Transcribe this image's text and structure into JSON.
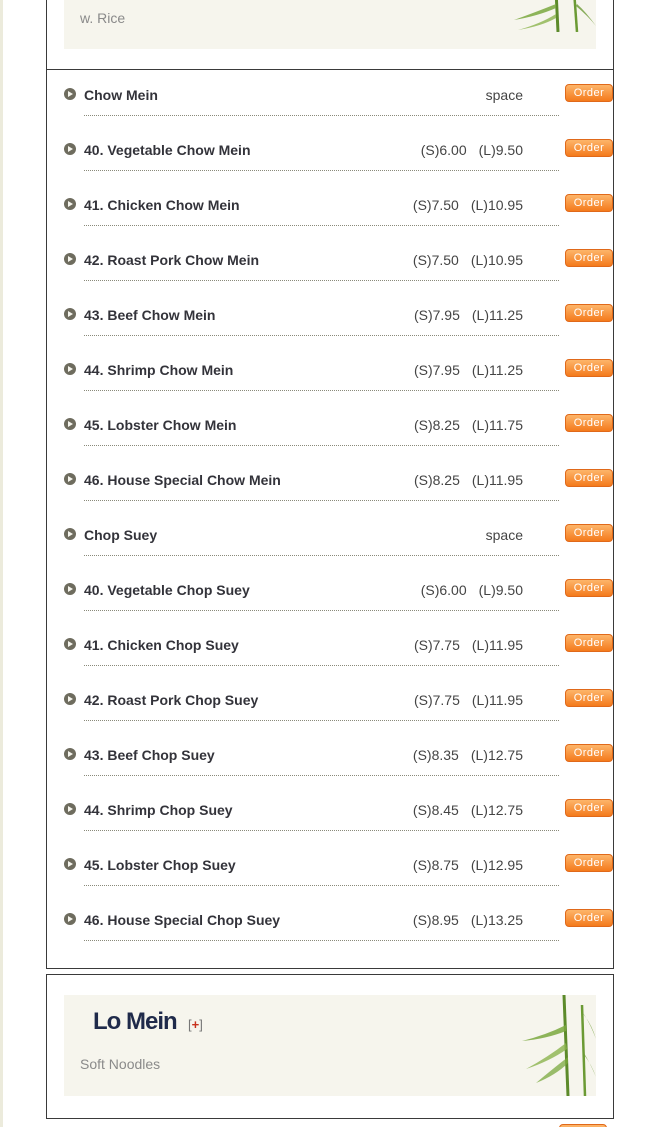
{
  "top_section": {
    "subtitle": "w. Rice"
  },
  "chow_mein_items": [
    {
      "name": "Chow Mein",
      "small": "space",
      "large": ""
    },
    {
      "name": "40. Vegetable Chow Mein",
      "small": "(S)6.00",
      "large": "(L)9.50"
    },
    {
      "name": "41. Chicken Chow Mein",
      "small": "(S)7.50",
      "large": "(L)10.95"
    },
    {
      "name": "42. Roast Pork Chow Mein",
      "small": "(S)7.50",
      "large": "(L)10.95"
    },
    {
      "name": "43. Beef Chow Mein",
      "small": "(S)7.95",
      "large": "(L)11.25"
    },
    {
      "name": "44. Shrimp Chow Mein",
      "small": "(S)7.95",
      "large": "(L)11.25"
    },
    {
      "name": "45. Lobster Chow Mein",
      "small": "(S)8.25",
      "large": "(L)11.75"
    },
    {
      "name": "46. House Special Chow Mein",
      "small": "(S)8.25",
      "large": "(L)11.95"
    },
    {
      "name": "Chop Suey",
      "small": "space",
      "large": ""
    },
    {
      "name": "40. Vegetable Chop Suey",
      "small": "(S)6.00",
      "large": "(L)9.50"
    },
    {
      "name": "41. Chicken Chop Suey",
      "small": "(S)7.75",
      "large": "(L)11.95"
    },
    {
      "name": "42. Roast Pork Chop Suey",
      "small": "(S)7.75",
      "large": "(L)11.95"
    },
    {
      "name": "43. Beef Chop Suey",
      "small": "(S)8.35",
      "large": "(L)12.75"
    },
    {
      "name": "44. Shrimp Chop Suey",
      "small": "(S)8.45",
      "large": "(L)12.75"
    },
    {
      "name": "45. Lobster Chop Suey",
      "small": "(S)8.75",
      "large": "(L)12.95"
    },
    {
      "name": "46. House Special Chop Suey",
      "small": "(S)8.95",
      "large": "(L)13.25"
    }
  ],
  "order_label": "Order",
  "lo_mein_section": {
    "title": "Lo Mein",
    "toggle_open": "[",
    "toggle_plus": "+",
    "toggle_close": "]",
    "subtitle": "Soft Noodles"
  },
  "colors": {
    "order_button": "#f47a1c",
    "title": "#1f2a4a",
    "border": "#3a3a3a",
    "panel": "#f6f5ed"
  },
  "icons": {
    "bullet": "circle-arrow-icon",
    "decoration": "bamboo-icon"
  }
}
